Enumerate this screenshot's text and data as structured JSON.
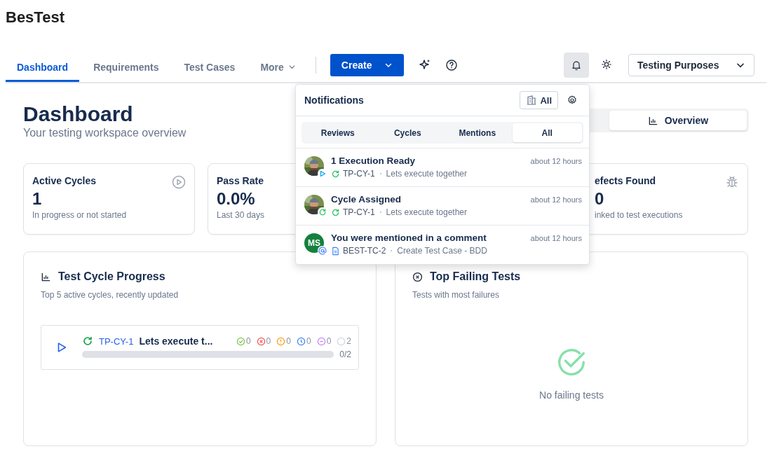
{
  "app_title": "BesTest",
  "nav": {
    "tabs": [
      {
        "label": "Dashboard",
        "selected": true,
        "has_menu": false
      },
      {
        "label": "Requirements",
        "selected": false,
        "has_menu": false
      },
      {
        "label": "Test Cases",
        "selected": false,
        "has_menu": false
      },
      {
        "label": "More",
        "selected": false,
        "has_menu": true
      }
    ],
    "create_button": "Create",
    "notifications_open": true,
    "project_select": "Testing Purposes"
  },
  "page": {
    "title": "Dashboard",
    "subtitle": "Your testing workspace overview"
  },
  "view_tabs": [
    {
      "label": "Overview",
      "selected": true
    }
  ],
  "stat_cards": [
    {
      "title": "Active Cycles",
      "value": "1",
      "caption": "In progress or not started",
      "kind": "active_cycles"
    },
    {
      "title": "Pass Rate",
      "value": "0.0%",
      "caption": "Last 30 days",
      "kind": "pass_rate"
    },
    {
      "title": "efects Found",
      "value": "0",
      "caption": "inked to test executions",
      "kind": "defects"
    }
  ],
  "panels": [
    {
      "kind": "cycle_progress",
      "title": "Test Cycle Progress",
      "subtitle": "Top 5 active cycles, recently updated",
      "cycles": [
        {
          "id": "TP-CY-1",
          "name": "Lets execute t...",
          "progress": "0/2",
          "level": 0,
          "counts": [
            {
              "kind": "passed",
              "color": "#7cc14a",
              "value": "0"
            },
            {
              "kind": "failed",
              "color": "#ef5350",
              "value": "0"
            },
            {
              "kind": "blocked",
              "color": "#f59e0b",
              "value": "0"
            },
            {
              "kind": "in_progress",
              "color": "#3b82f6",
              "value": "0"
            },
            {
              "kind": "skipped",
              "color": "#c084fc",
              "value": "0"
            },
            {
              "kind": "not_run",
              "color": "#d1d5db",
              "value": "2"
            }
          ]
        }
      ]
    },
    {
      "kind": "failing_tests",
      "title": "Top Failing Tests",
      "subtitle": "Tests with most failures",
      "empty_text": "No failing tests"
    }
  ],
  "notifications": {
    "title": "Notifications",
    "filter_button": "All",
    "tabs": [
      {
        "label": "Reviews",
        "selected": false
      },
      {
        "label": "Cycles",
        "selected": false
      },
      {
        "label": "Mentions",
        "selected": false
      },
      {
        "label": "All",
        "selected": true
      }
    ],
    "items": [
      {
        "title": "1 Execution Ready",
        "time": "about 12 hours",
        "kind": "execution_ready",
        "ref": "TP-CY-1",
        "text": "Lets execute together"
      },
      {
        "title": "Cycle Assigned",
        "time": "about 12 hours",
        "kind": "cycle_assigned",
        "ref": "TP-CY-1",
        "text": "Lets execute together"
      },
      {
        "title": "You were mentioned in a comment",
        "time": "about 12 hours",
        "avatar": {
          "kind": "initials",
          "text": "MS"
        },
        "kind": "mention",
        "ref": "BEST-TC-2",
        "text": "Create Test Case - BDD"
      }
    ]
  }
}
